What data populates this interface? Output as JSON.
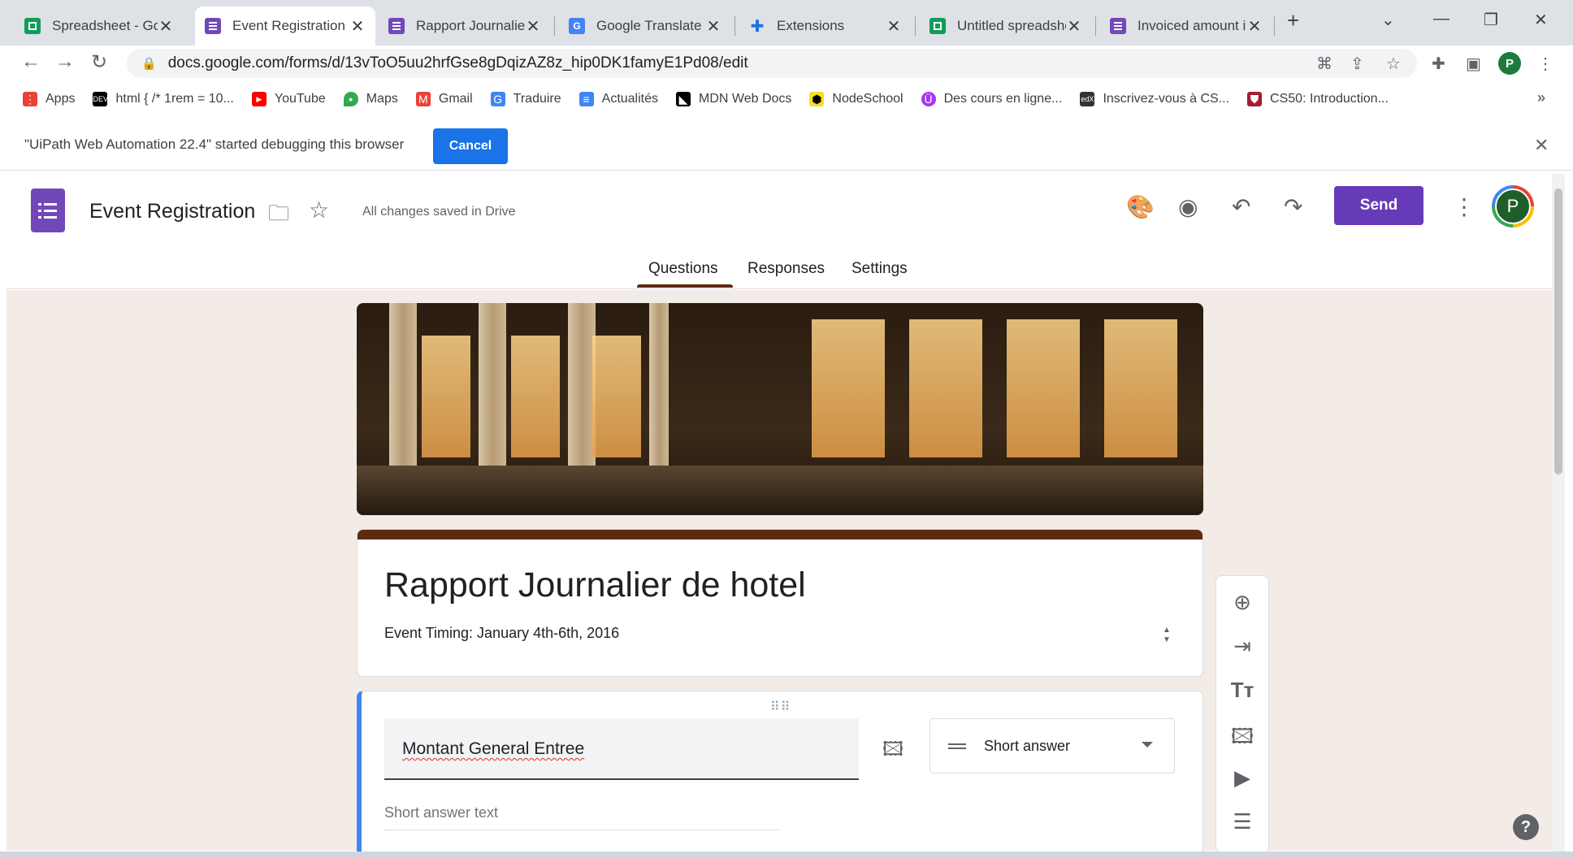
{
  "browser": {
    "tabs": [
      {
        "title": "Spreadsheet - Goo",
        "icon": "sheets-icon"
      },
      {
        "title": "Event Registration",
        "icon": "forms-icon",
        "active": true
      },
      {
        "title": "Rapport Journalier",
        "icon": "forms-icon"
      },
      {
        "title": "Google Translate",
        "icon": "translate-icon"
      },
      {
        "title": "Extensions",
        "icon": "puzzle-icon"
      },
      {
        "title": "Untitled spreadshe",
        "icon": "sheets-icon"
      },
      {
        "title": "Invoiced amount ir",
        "icon": "forms-icon"
      }
    ],
    "new_tab": "+",
    "url": "docs.google.com/forms/d/13vToO5uu2hrfGse8gDqizAZ8z_hip0DK1famyE1Pd08/edit",
    "profile_initial": "P",
    "bookmarks": [
      {
        "label": "Apps",
        "icon": "apps-grid-icon",
        "color": "#ea4335"
      },
      {
        "label": "html { /* 1rem = 10...",
        "icon": "dev-icon",
        "color": "#000000"
      },
      {
        "label": "YouTube",
        "icon": "youtube-icon",
        "color": "#ff0000"
      },
      {
        "label": "Maps",
        "icon": "maps-icon",
        "color": "#34a853"
      },
      {
        "label": "Gmail",
        "icon": "gmail-icon",
        "color": "#ea4335"
      },
      {
        "label": "Traduire",
        "icon": "translate-icon",
        "color": "#4285f4"
      },
      {
        "label": "Actualités",
        "icon": "news-icon",
        "color": "#4285f4"
      },
      {
        "label": "MDN Web Docs",
        "icon": "mdn-icon",
        "color": "#000000"
      },
      {
        "label": "NodeSchool",
        "icon": "nodeschool-icon",
        "color": "#f7df1e"
      },
      {
        "label": "Des cours en ligne...",
        "icon": "udemy-icon",
        "color": "#a435f0"
      },
      {
        "label": "Inscrivez-vous à CS...",
        "icon": "edx-icon",
        "color": "#333333"
      },
      {
        "label": "CS50: Introduction...",
        "icon": "harvard-icon",
        "color": "#a51c30"
      }
    ],
    "bookmarks_more": "»"
  },
  "infobar": {
    "message": "\"UiPath Web Automation 22.4\" started debugging this browser",
    "cancel_label": "Cancel"
  },
  "forms_header": {
    "doc_title": "Event Registration",
    "saved_status": "All changes saved in Drive",
    "send_label": "Send",
    "avatar_initial": "P",
    "tabs": [
      "Questions",
      "Responses",
      "Settings"
    ],
    "active_tab": "Questions",
    "accent_color": "#673ab7",
    "theme_color": "#5d2a0f"
  },
  "form": {
    "title": "Rapport Journalier de hotel",
    "description": "Event Timing: January 4th-6th, 2016",
    "question": {
      "title": "Montant General Entree",
      "type": "Short answer",
      "answer_placeholder": "Short answer text"
    }
  },
  "side_tools": [
    "add-question-icon",
    "import-questions-icon",
    "add-title-icon",
    "add-image-icon",
    "add-video-icon",
    "add-section-icon"
  ],
  "help_label": "?"
}
